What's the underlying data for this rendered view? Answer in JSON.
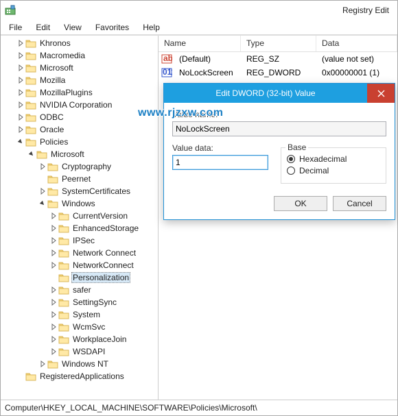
{
  "app": {
    "title": "Registry Edit"
  },
  "menu": {
    "file": "File",
    "edit": "Edit",
    "view": "View",
    "favorites": "Favorites",
    "help": "Help"
  },
  "tree": {
    "items": [
      {
        "label": "Khronos",
        "depth": 1,
        "exp": "closed"
      },
      {
        "label": "Macromedia",
        "depth": 1,
        "exp": "closed"
      },
      {
        "label": "Microsoft",
        "depth": 1,
        "exp": "closed"
      },
      {
        "label": "Mozilla",
        "depth": 1,
        "exp": "closed"
      },
      {
        "label": "MozillaPlugins",
        "depth": 1,
        "exp": "closed"
      },
      {
        "label": "NVIDIA Corporation",
        "depth": 1,
        "exp": "closed"
      },
      {
        "label": "ODBC",
        "depth": 1,
        "exp": "closed"
      },
      {
        "label": "Oracle",
        "depth": 1,
        "exp": "closed"
      },
      {
        "label": "Policies",
        "depth": 1,
        "exp": "open"
      },
      {
        "label": "Microsoft",
        "depth": 2,
        "exp": "open"
      },
      {
        "label": "Cryptography",
        "depth": 3,
        "exp": "closed"
      },
      {
        "label": "Peernet",
        "depth": 3,
        "exp": "none"
      },
      {
        "label": "SystemCertificates",
        "depth": 3,
        "exp": "closed"
      },
      {
        "label": "Windows",
        "depth": 3,
        "exp": "open"
      },
      {
        "label": "CurrentVersion",
        "depth": 4,
        "exp": "closed"
      },
      {
        "label": "EnhancedStorage",
        "depth": 4,
        "exp": "closed"
      },
      {
        "label": "IPSec",
        "depth": 4,
        "exp": "closed"
      },
      {
        "label": "Network Connect",
        "depth": 4,
        "exp": "closed"
      },
      {
        "label": "NetworkConnect",
        "depth": 4,
        "exp": "closed"
      },
      {
        "label": "Personalization",
        "depth": 4,
        "exp": "none",
        "selected": true
      },
      {
        "label": "safer",
        "depth": 4,
        "exp": "closed"
      },
      {
        "label": "SettingSync",
        "depth": 4,
        "exp": "closed"
      },
      {
        "label": "System",
        "depth": 4,
        "exp": "closed"
      },
      {
        "label": "WcmSvc",
        "depth": 4,
        "exp": "closed"
      },
      {
        "label": "WorkplaceJoin",
        "depth": 4,
        "exp": "closed"
      },
      {
        "label": "WSDAPI",
        "depth": 4,
        "exp": "closed"
      },
      {
        "label": "Windows NT",
        "depth": 3,
        "exp": "closed"
      },
      {
        "label": "RegisteredApplications",
        "depth": 1,
        "exp": "none"
      }
    ]
  },
  "list": {
    "header": {
      "name": "Name",
      "type": "Type",
      "data": "Data"
    },
    "rows": [
      {
        "icon": "string",
        "name": "(Default)",
        "type": "REG_SZ",
        "data": "(value not set)"
      },
      {
        "icon": "binary",
        "name": "NoLockScreen",
        "type": "REG_DWORD",
        "data": "0x00000001 (1)"
      }
    ]
  },
  "dialog": {
    "title": "Edit DWORD (32-bit) Value",
    "valueNameLabel": "Value name:",
    "valueName": "NoLockScreen",
    "valueDataLabel": "Value data:",
    "valueData": "1",
    "baseLabel": "Base",
    "hex": "Hexadecimal",
    "dec": "Decimal",
    "ok": "OK",
    "cancel": "Cancel"
  },
  "status": {
    "path": "Computer\\HKEY_LOCAL_MACHINE\\SOFTWARE\\Policies\\Microsoft\\"
  },
  "watermark": "www.rjzxw.com"
}
